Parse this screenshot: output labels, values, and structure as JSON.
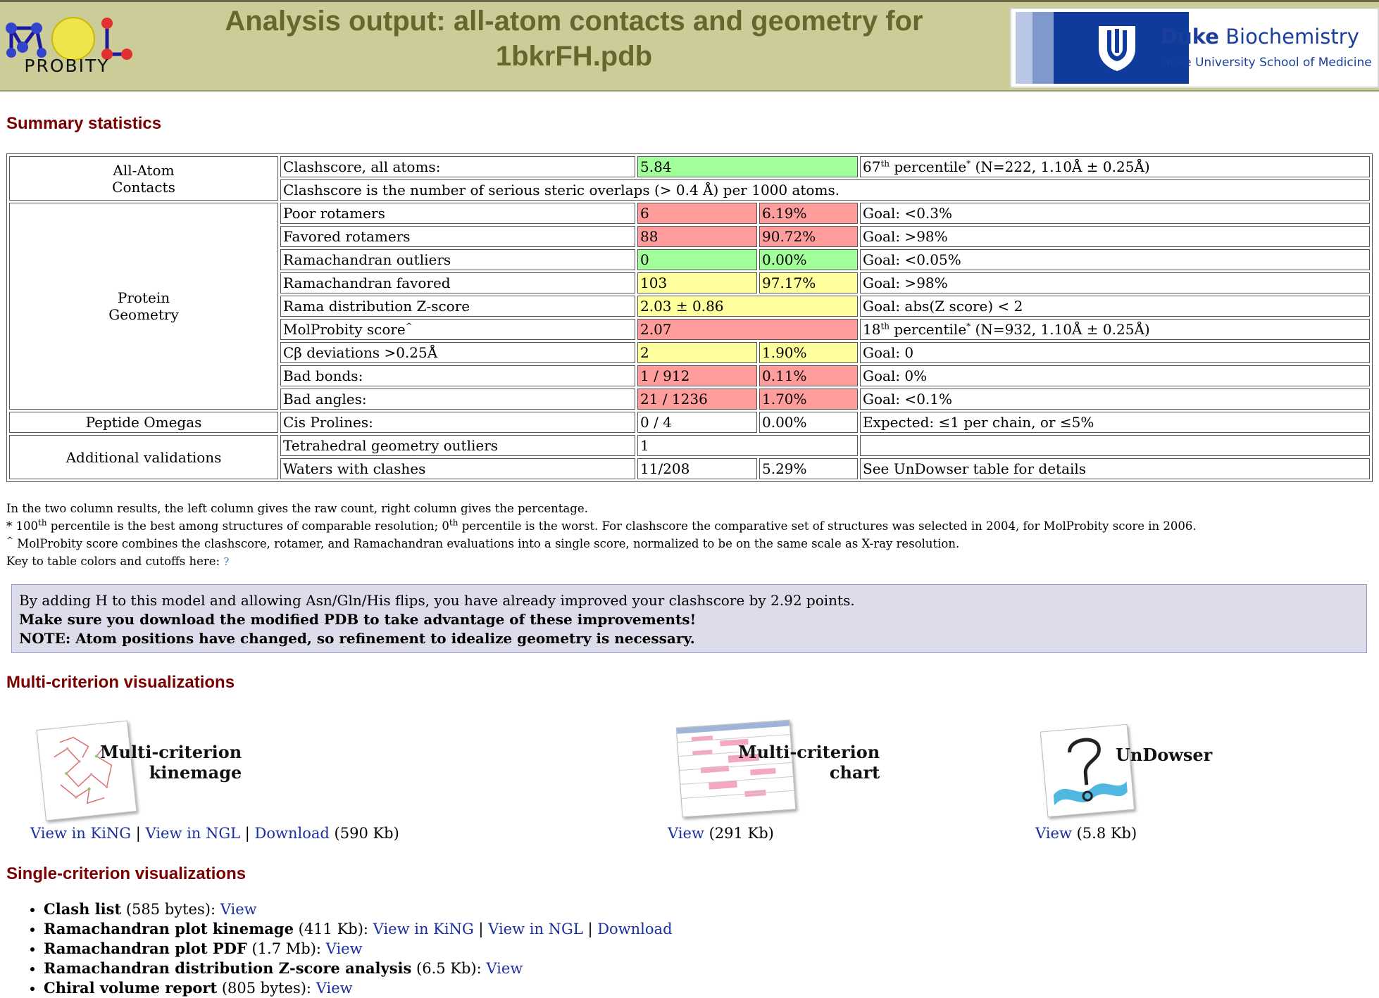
{
  "header": {
    "logo_word": "PROBITY",
    "title": "Analysis output: all-atom contacts and geometry for 1bkrFH.pdb",
    "duke_name_bold": "Duke",
    "duke_name_rest": "Biochemistry",
    "duke_sub": "Duke University School of Medicine"
  },
  "summary": {
    "heading": "Summary statistics",
    "rows": [
      {
        "cat": "All-Atom\nContacts",
        "label": "Clashscore, all atoms:",
        "v1": "5.84",
        "v2": "",
        "goal_pre": "67",
        "goal_sup": "th",
        "goal_mid": " percentile",
        "goal_star": "*",
        "goal_post": " (N=222, 1.10Å ± 0.25Å)"
      },
      {
        "label": "Clashscore is the number of serious steric overlaps (> 0.4 Å) per 1000 atoms."
      },
      {
        "cat": "Protein\nGeometry",
        "label": "Poor rotamers",
        "v1": "6",
        "v2": "6.19%",
        "goal": "Goal: <0.3%"
      },
      {
        "label": "Favored rotamers",
        "v1": "88",
        "v2": "90.72%",
        "goal": "Goal: >98%"
      },
      {
        "label": "Ramachandran outliers",
        "v1": "0",
        "v2": "0.00%",
        "goal": "Goal: <0.05%"
      },
      {
        "label": "Ramachandran favored",
        "v1": "103",
        "v2": "97.17%",
        "goal": "Goal: >98%"
      },
      {
        "label": "Rama distribution Z-score",
        "v1": "2.03 ± 0.86",
        "goal": "Goal: abs(Z score) < 2"
      },
      {
        "label": "MolProbity score",
        "label_sup": "^",
        "v1": "2.07",
        "goal_pre": "18",
        "goal_sup": "th",
        "goal_mid": " percentile",
        "goal_star": "*",
        "goal_post": " (N=932, 1.10Å ± 0.25Å)"
      },
      {
        "label": "Cβ deviations >0.25Å",
        "v1": "2",
        "v2": "1.90%",
        "goal": "Goal: 0"
      },
      {
        "label": "Bad bonds:",
        "v1": "1 / 912",
        "v2": "0.11%",
        "goal": "Goal: 0%"
      },
      {
        "label": "Bad angles:",
        "v1": "21 / 1236",
        "v2": "1.70%",
        "goal": "Goal: <0.1%"
      },
      {
        "cat": "Peptide Omegas",
        "label": "Cis Prolines:",
        "v1": "0 / 4",
        "v2": "0.00%",
        "goal": "Expected: ≤1 per chain, or ≤5%"
      },
      {
        "cat": "Additional validations",
        "label": "Tetrahedral geometry outliers",
        "v1": "1",
        "goal": ""
      },
      {
        "label": "Waters with clashes",
        "v1": "11/208",
        "v2": "5.29%",
        "goal": "See UnDowser table for details"
      }
    ],
    "colors": {
      "good": "#a0ff98",
      "bad": "#ff9d9d",
      "warn": "#ffff9d"
    }
  },
  "footnotes": {
    "line1": "In the two column results, the left column gives the raw count, right column gives the percentage.",
    "line2_a": "* 100",
    "line2_sup1": "th",
    "line2_b": " percentile is the best among structures of comparable resolution; 0",
    "line2_sup2": "th",
    "line2_c": " percentile is the worst. For clashscore the comparative set of structures was selected in 2004, for MolProbity score in 2006.",
    "line3_sup": "^",
    "line3": " MolProbity score combines the clashscore, rotamer, and Ramachandran evaluations into a single score, normalized to be on the same scale as X-ray resolution.",
    "line4": "Key to table colors and cutoffs here: "
  },
  "notice": {
    "line1": "By adding H to this model and allowing Asn/Gln/His flips, you have already improved your clashscore by 2.92 points.",
    "line2": "Make sure you download the modified PDB to take advantage of these improvements!",
    "line3": "NOTE: Atom positions have changed, so refinement to idealize geometry is necessary."
  },
  "multi": {
    "heading": "Multi-criterion visualizations",
    "kinemage": {
      "label1": "Multi-criterion",
      "label2": "kinemage",
      "link1": "View in KiNG",
      "link2": "View in NGL",
      "link3": "Download",
      "size": " (590 Kb)"
    },
    "chart": {
      "label1": "Multi-criterion",
      "label2": "chart",
      "link1": "View",
      "size": " (291 Kb)"
    },
    "undowser": {
      "label1": "UnDowser",
      "link1": "View",
      "size": " (5.8 Kb)"
    }
  },
  "single": {
    "heading": "Single-criterion visualizations",
    "items": [
      {
        "name": "Clash list",
        "size": " (585 bytes): ",
        "links": [
          "View"
        ]
      },
      {
        "name": "Ramachandran plot kinemage",
        "size": " (411 Kb): ",
        "links": [
          "View in KiNG",
          "View in NGL",
          "Download"
        ]
      },
      {
        "name": "Ramachandran plot PDF",
        "size": " (1.7 Mb): ",
        "links": [
          "View"
        ]
      },
      {
        "name": "Ramachandran distribution Z-score analysis",
        "size": " (6.5 Kb): ",
        "links": [
          "View"
        ]
      },
      {
        "name": "Chiral volume report",
        "size": " (805 bytes): ",
        "links": [
          "View"
        ]
      }
    ]
  }
}
